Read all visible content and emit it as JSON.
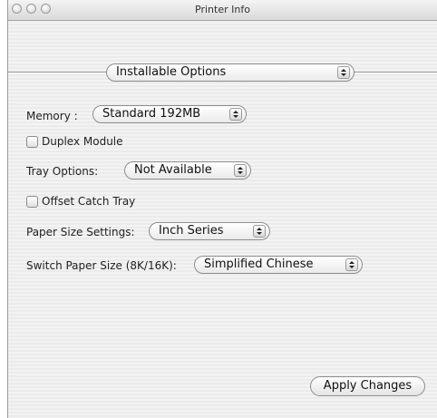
{
  "window": {
    "title": "Printer Info"
  },
  "section_popup": {
    "value": "Installable Options"
  },
  "memory": {
    "label": "Memory :",
    "value": "Standard 192MB"
  },
  "duplex": {
    "label": "Duplex Module",
    "checked": false
  },
  "tray_options": {
    "label": "Tray Options:",
    "value": "Not Available"
  },
  "offset_catch_tray": {
    "label": "Offset Catch Tray",
    "checked": false
  },
  "paper_size_settings": {
    "label": "Paper Size Settings:",
    "value": "Inch Series"
  },
  "switch_paper_size": {
    "label": "Switch Paper Size (8K/16K):",
    "value": "Simplified Chinese"
  },
  "apply_button": {
    "label": "Apply Changes"
  },
  "icons": {
    "popup_arrows": "up-down-arrows-icon"
  }
}
